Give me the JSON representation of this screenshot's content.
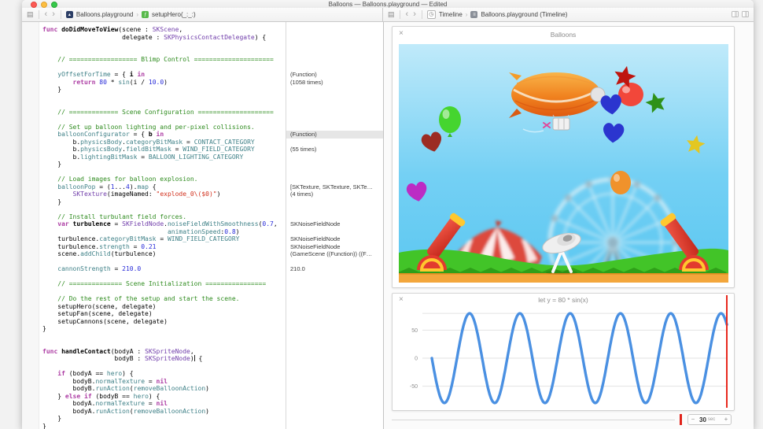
{
  "window": {
    "title": "Balloons — Balloons.playground — Edited"
  },
  "icons": {
    "related_items": "▤",
    "back": "‹",
    "forward": "›",
    "crumb_separator": "›",
    "playground_file_glyph": "▴",
    "function_glyph": "ƒ",
    "timeline_glyph": "◷",
    "timeline_doc_glyph": "≡",
    "close": "×",
    "minus": "−",
    "plus": "+"
  },
  "editor_jumpbar": {
    "file": "Balloons.playground",
    "symbol": "setupHero(_:_:)"
  },
  "timeline_jumpbar": {
    "pane": "Timeline",
    "document": "Balloons.playground (Timeline)"
  },
  "code": {
    "lines": [
      {
        "s": [
          [
            "k",
            "func "
          ],
          [
            "d",
            "doDidMoveToView"
          ],
          [
            "p",
            "(scene : "
          ],
          [
            "t",
            "SKScene"
          ],
          [
            "p",
            ","
          ]
        ]
      },
      {
        "s": [
          [
            "p",
            "                     delegate : "
          ],
          [
            "t",
            "SKPhysicsContactDelegate"
          ],
          [
            "p",
            ") {"
          ]
        ]
      },
      {},
      {},
      {
        "s": [
          [
            "c",
            "    // ================== Blimp Control ====================="
          ]
        ]
      },
      {},
      {
        "s": [
          [
            "p",
            "    "
          ],
          [
            "m",
            "yOffsetForTime"
          ],
          [
            "p",
            " = { "
          ],
          [
            "d",
            "i "
          ],
          [
            "k",
            "in"
          ]
        ]
      },
      {
        "s": [
          [
            "p",
            "        "
          ],
          [
            "k",
            "return "
          ],
          [
            "n",
            "80"
          ],
          [
            "p",
            " * "
          ],
          [
            "m",
            "sin"
          ],
          [
            "p",
            "(i / "
          ],
          [
            "n",
            "10.0"
          ],
          [
            "p",
            ")"
          ]
        ]
      },
      {
        "s": [
          [
            "p",
            "    }"
          ]
        ]
      },
      {},
      {},
      {
        "s": [
          [
            "c",
            "    // ============= Scene Configuration ===================="
          ]
        ]
      },
      {},
      {
        "s": [
          [
            "c",
            "    // Set up balloon lighting and per-pixel collisions."
          ]
        ]
      },
      {
        "s": [
          [
            "p",
            "    "
          ],
          [
            "m",
            "balloonConfigurator"
          ],
          [
            "p",
            " = { "
          ],
          [
            "d",
            "b "
          ],
          [
            "k",
            "in"
          ]
        ]
      },
      {
        "s": [
          [
            "p",
            "        b."
          ],
          [
            "m",
            "physicsBody"
          ],
          [
            "p",
            "."
          ],
          [
            "m",
            "categoryBitMask"
          ],
          [
            "p",
            " = "
          ],
          [
            "m",
            "CONTACT_CATEGORY"
          ]
        ]
      },
      {
        "s": [
          [
            "p",
            "        b."
          ],
          [
            "m",
            "physicsBody"
          ],
          [
            "p",
            "."
          ],
          [
            "m",
            "fieldBitMask"
          ],
          [
            "p",
            " = "
          ],
          [
            "m",
            "WIND_FIELD_CATEGORY"
          ]
        ]
      },
      {
        "s": [
          [
            "p",
            "        b."
          ],
          [
            "m",
            "lightingBitMask"
          ],
          [
            "p",
            " = "
          ],
          [
            "m",
            "BALLOON_LIGHTING_CATEGORY"
          ]
        ]
      },
      {
        "s": [
          [
            "p",
            "    }"
          ]
        ]
      },
      {},
      {
        "s": [
          [
            "c",
            "    // Load images for balloon explosion."
          ]
        ]
      },
      {
        "s": [
          [
            "p",
            "    "
          ],
          [
            "m",
            "balloonPop"
          ],
          [
            "p",
            " = ("
          ],
          [
            "n",
            "1"
          ],
          [
            "p",
            "..."
          ],
          [
            "n",
            "4"
          ],
          [
            "p",
            ")."
          ],
          [
            "m",
            "map"
          ],
          [
            "p",
            " {"
          ]
        ]
      },
      {
        "s": [
          [
            "p",
            "        "
          ],
          [
            "t",
            "SKTexture"
          ],
          [
            "p",
            "(imageNamed: "
          ],
          [
            "str",
            "\"explode_0\\($0)\""
          ],
          [
            "p",
            ")"
          ]
        ]
      },
      {
        "s": [
          [
            "p",
            "    }"
          ]
        ]
      },
      {},
      {
        "s": [
          [
            "c",
            "    // Install turbulant field forces."
          ]
        ]
      },
      {
        "s": [
          [
            "p",
            "    "
          ],
          [
            "k",
            "var "
          ],
          [
            "d",
            "turbulence"
          ],
          [
            "p",
            " = "
          ],
          [
            "t",
            "SKFieldNode"
          ],
          [
            "p",
            "."
          ],
          [
            "m",
            "noiseFieldWithSmoothness"
          ],
          [
            "p",
            "("
          ],
          [
            "n",
            "0.7"
          ],
          [
            "p",
            ","
          ]
        ]
      },
      {
        "s": [
          [
            "p",
            "                                 "
          ],
          [
            "m",
            "animationSpeed"
          ],
          [
            "p",
            ":"
          ],
          [
            "n",
            "0.8"
          ],
          [
            "p",
            ")"
          ]
        ]
      },
      {
        "s": [
          [
            "p",
            "    turbulence."
          ],
          [
            "m",
            "categoryBitMask"
          ],
          [
            "p",
            " = "
          ],
          [
            "m",
            "WIND_FIELD_CATEGORY"
          ]
        ]
      },
      {
        "s": [
          [
            "p",
            "    turbulence."
          ],
          [
            "m",
            "strength"
          ],
          [
            "p",
            " = "
          ],
          [
            "n",
            "0.21"
          ]
        ]
      },
      {
        "s": [
          [
            "p",
            "    scene."
          ],
          [
            "m",
            "addChild"
          ],
          [
            "p",
            "(turbulence)"
          ]
        ]
      },
      {},
      {
        "s": [
          [
            "p",
            "    "
          ],
          [
            "m",
            "cannonStrength"
          ],
          [
            "p",
            " = "
          ],
          [
            "n",
            "210.0"
          ]
        ]
      },
      {},
      {
        "s": [
          [
            "c",
            "    // ============== Scene Initialization ================"
          ]
        ]
      },
      {},
      {
        "s": [
          [
            "c",
            "    // Do the rest of the setup and start the scene."
          ]
        ]
      },
      {
        "s": [
          [
            "p",
            "    setupHero(scene, delegate)"
          ]
        ]
      },
      {
        "s": [
          [
            "p",
            "    setupFan(scene, delegate)"
          ]
        ]
      },
      {
        "s": [
          [
            "p",
            "    setupCannons(scene, delegate)"
          ]
        ]
      },
      {
        "s": [
          [
            "p",
            "}"
          ]
        ]
      },
      {},
      {},
      {
        "s": [
          [
            "k",
            "func "
          ],
          [
            "d",
            "handleContact"
          ],
          [
            "p",
            "(bodyA : "
          ],
          [
            "t",
            "SKSpriteNode"
          ],
          [
            "p",
            ","
          ]
        ]
      },
      {
        "s": [
          [
            "p",
            "                   bodyB : "
          ],
          [
            "t",
            "SKSpriteNode"
          ],
          [
            "p",
            ")"
          ],
          [
            "caret",
            ""
          ],
          [
            "p",
            " {"
          ]
        ]
      },
      {},
      {
        "s": [
          [
            "p",
            "    "
          ],
          [
            "k",
            "if"
          ],
          [
            "p",
            " (bodyA == "
          ],
          [
            "m",
            "hero"
          ],
          [
            "p",
            ") {"
          ]
        ]
      },
      {
        "s": [
          [
            "p",
            "        bodyB."
          ],
          [
            "m",
            "normalTexture"
          ],
          [
            "p",
            " = "
          ],
          [
            "k",
            "nil"
          ]
        ]
      },
      {
        "s": [
          [
            "p",
            "        bodyB."
          ],
          [
            "m",
            "runAction"
          ],
          [
            "p",
            "("
          ],
          [
            "m",
            "removeBalloonAction"
          ],
          [
            "p",
            ")"
          ]
        ]
      },
      {
        "s": [
          [
            "p",
            "    } "
          ],
          [
            "k",
            "else"
          ],
          [
            "p",
            " "
          ],
          [
            "k",
            "if"
          ],
          [
            "p",
            " (bodyB == "
          ],
          [
            "m",
            "hero"
          ],
          [
            "p",
            ") {"
          ]
        ]
      },
      {
        "s": [
          [
            "p",
            "        bodyA."
          ],
          [
            "m",
            "normalTexture"
          ],
          [
            "p",
            " = "
          ],
          [
            "k",
            "nil"
          ]
        ]
      },
      {
        "s": [
          [
            "p",
            "        bodyA."
          ],
          [
            "m",
            "runAction"
          ],
          [
            "p",
            "("
          ],
          [
            "m",
            "removeBalloonAction"
          ],
          [
            "p",
            ")"
          ]
        ]
      },
      {
        "s": [
          [
            "p",
            "    }"
          ]
        ]
      },
      {
        "s": [
          [
            "p",
            "}"
          ]
        ]
      }
    ]
  },
  "results": [
    {
      "line": 6,
      "text": "(Function)"
    },
    {
      "line": 7,
      "text": "(1058 times)"
    },
    {
      "line": 14,
      "text": "(Function)",
      "highlighted": true
    },
    {
      "line": 16,
      "text": "(55 times)"
    },
    {
      "line": 21,
      "text": "[SKTexture, SKTexture, SKTe…"
    },
    {
      "line": 22,
      "text": "(4 times)"
    },
    {
      "line": 26,
      "text": "SKNoiseFieldNode"
    },
    {
      "line": 28,
      "text": "SKNoiseFieldNode"
    },
    {
      "line": 29,
      "text": "SKNoiseFieldNode"
    },
    {
      "line": 30,
      "text": "(GameScene ((Function)) ((F…"
    },
    {
      "line": 32,
      "text": "210.0"
    }
  ],
  "live_view": {
    "title": "Balloons"
  },
  "chart_data": {
    "type": "line",
    "title": "let y = 80 * sin(x)",
    "series": [
      {
        "name": "y",
        "expression": "80 * sin(x)",
        "amplitude": 80,
        "cycles_visible": 5.88,
        "starts_at_value": 0,
        "initial_direction": "down"
      }
    ],
    "yticks": [
      50,
      0,
      -50
    ],
    "gridlines": [
      80,
      50,
      0,
      -50
    ],
    "ylim": [
      -90,
      90
    ],
    "x_window_seconds": 30,
    "line_color": "#4A90E2",
    "grid_color": "#E2E2E2",
    "grid": true,
    "legend": false
  },
  "timeline_scrubber": {
    "value": "30",
    "unit": "sec"
  },
  "colors": {
    "playhead_red": "#E8291E",
    "keyword": "#AD3DA4",
    "type": "#703DAA",
    "member": "#3E8087",
    "comment": "#2E8B1E",
    "number": "#272AD8",
    "string": "#D12F1B"
  }
}
